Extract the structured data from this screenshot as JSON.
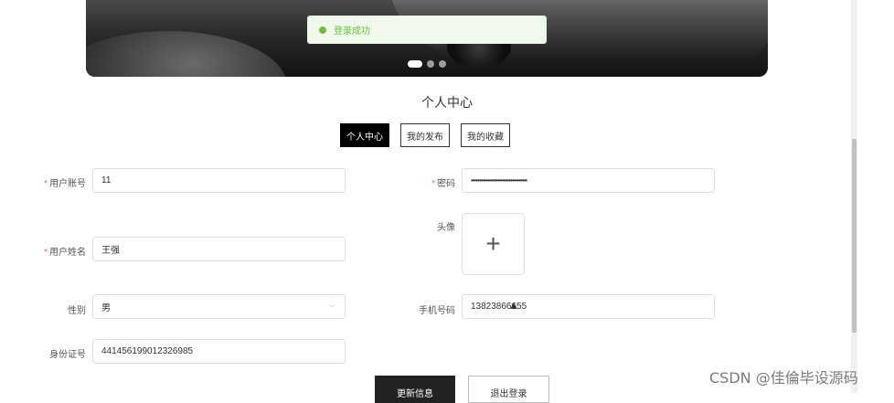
{
  "toast": {
    "message": "登录成功"
  },
  "banner": {
    "slides": 3,
    "active_slide": 1
  },
  "page": {
    "title": "个人中心"
  },
  "tabs": [
    {
      "label": "个人中心",
      "active": true
    },
    {
      "label": "我的发布",
      "active": false
    },
    {
      "label": "我的收藏",
      "active": false
    }
  ],
  "form": {
    "account": {
      "label": "用户账号",
      "required": "*",
      "value": "11"
    },
    "password": {
      "label": "密码",
      "required": "*",
      "value": "••••••••••••••••••••••••••••••••••"
    },
    "avatar": {
      "label": "头像",
      "upload_glyph": "+"
    },
    "name": {
      "label": "用户姓名",
      "required": "*",
      "value": "王强"
    },
    "gender": {
      "label": "性别",
      "value": "男",
      "chevron": "﹀"
    },
    "phone": {
      "label": "手机号码",
      "value": "13823866655"
    },
    "idcard": {
      "label": "身份证号",
      "value": "441456199012326985"
    }
  },
  "buttons": {
    "update": "更新信息",
    "logout": "退出登录"
  },
  "watermark": "CSDN @佳倫毕设源码",
  "colors": {
    "success": "#67c23a",
    "required": "#f56c6c",
    "primary_button": "#222222"
  }
}
